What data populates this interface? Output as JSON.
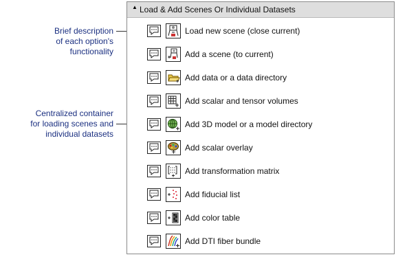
{
  "panel": {
    "title": "Load & Add Scenes Or Individual Datasets",
    "items": [
      {
        "label": "Load new scene (close current)",
        "icon": "load-scene-icon"
      },
      {
        "label": "Add a scene (to current)",
        "icon": "add-scene-icon"
      },
      {
        "label": "Add data or a data directory",
        "icon": "add-data-folder-icon"
      },
      {
        "label": "Add scalar and tensor volumes",
        "icon": "volume-grid-icon"
      },
      {
        "label": "Add 3D model or a model directory",
        "icon": "model-sphere-icon"
      },
      {
        "label": "Add scalar overlay",
        "icon": "scalar-overlay-icon"
      },
      {
        "label": "Add transformation matrix",
        "icon": "transform-matrix-icon"
      },
      {
        "label": "Add fiducial list",
        "icon": "fiducial-list-icon"
      },
      {
        "label": "Add color table",
        "icon": "color-table-icon"
      },
      {
        "label": "Add DTI fiber bundle",
        "icon": "fiber-bundle-icon"
      }
    ]
  },
  "annotations": {
    "help_buttons": [
      "Brief description",
      "of each option's",
      "functionality"
    ],
    "container": [
      "Centralized container",
      "for loading scenes and",
      "individual datasets"
    ]
  },
  "colors": {
    "annotation_text": "#1a2f80",
    "header_bg": "#dedede",
    "border": "#8a8a8a"
  }
}
